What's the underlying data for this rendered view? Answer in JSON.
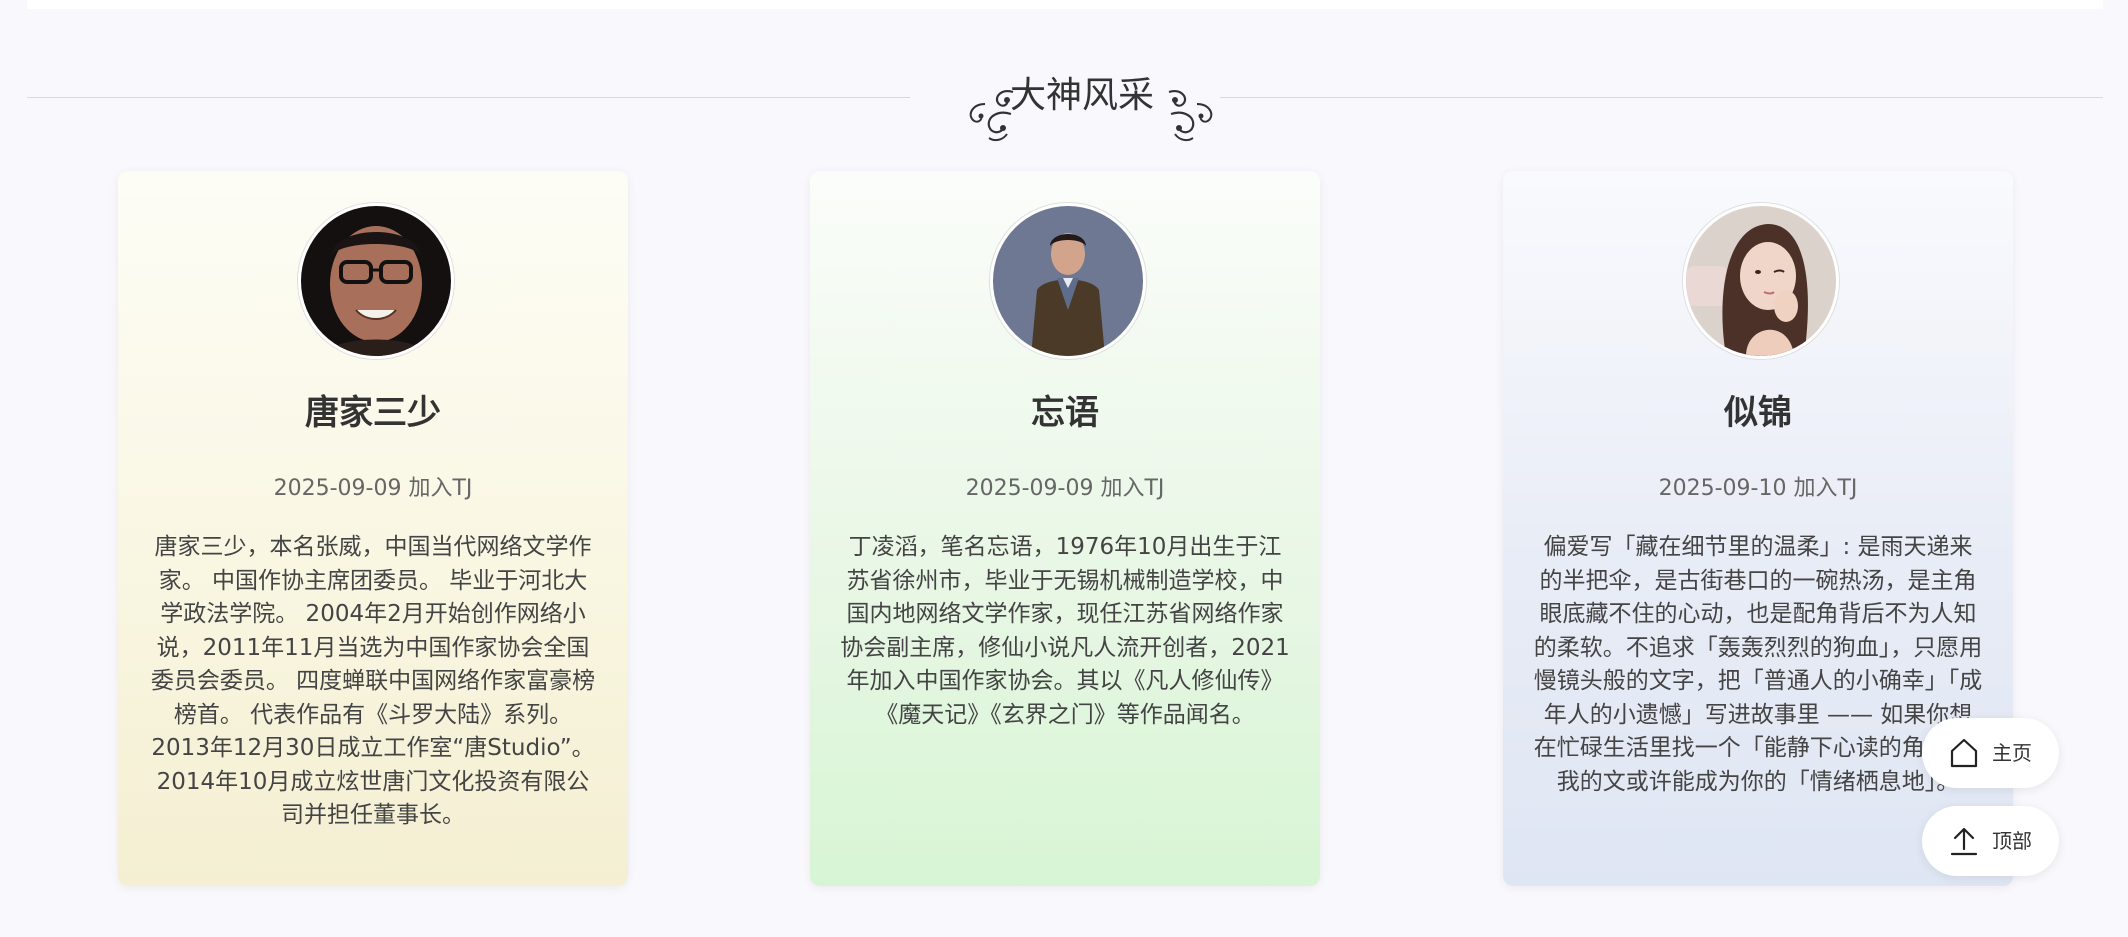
{
  "section": {
    "title": "大神风采"
  },
  "authors": [
    {
      "name": "唐家三少",
      "joined": "2025-09-09 加入TJ",
      "bio": "唐家三少，本名张威，中国当代网络文学作家。 中国作协主席团委员。 毕业于河北大学政法学院。 2004年2月开始创作网络小说，2011年11月当选为中国作家协会全国委员会委员。 四度蝉联中国网络作家富豪榜榜首。 代表作品有《斗罗大陆》系列。 2013年12月30日成立工作室“唐Studio”。 2014年10月成立炫世唐门文化投资有限公司并担任董事长。"
    },
    {
      "name": "忘语",
      "joined": "2025-09-09 加入TJ",
      "bio": "丁凌滔，笔名忘语，1976年10月出生于江苏省徐州市，毕业于无锡机械制造学校，中国内地网络文学作家，现任江苏省网络作家协会副主席，修仙小说凡人流开创者，2021年加入中国作家协会。其以《凡人修仙传》《魔天记》《玄界之门》等作品闻名。"
    },
    {
      "name": "似锦",
      "joined": "2025-09-10 加入TJ",
      "bio": "偏爱写「藏在细节里的温柔」: 是雨天递来的半把伞，是古街巷口的一碗热汤，是主角眼底藏不住的心动，也是配角背后不为人知的柔软。不追求「轰轰烈烈的狗血」，只愿用慢镜头般的文字，把「普通人的小确幸」「成年人的小遗憾」写进故事里 —— 如果你想在忙碌生活里找一个「能静下心读的角落」，我的文或许能成为你的「情绪栖息地」。"
    }
  ],
  "float_nav": {
    "home_label": "主页",
    "home_icon": "home-icon",
    "top_label": "顶部",
    "top_icon": "arrow-up-icon"
  }
}
